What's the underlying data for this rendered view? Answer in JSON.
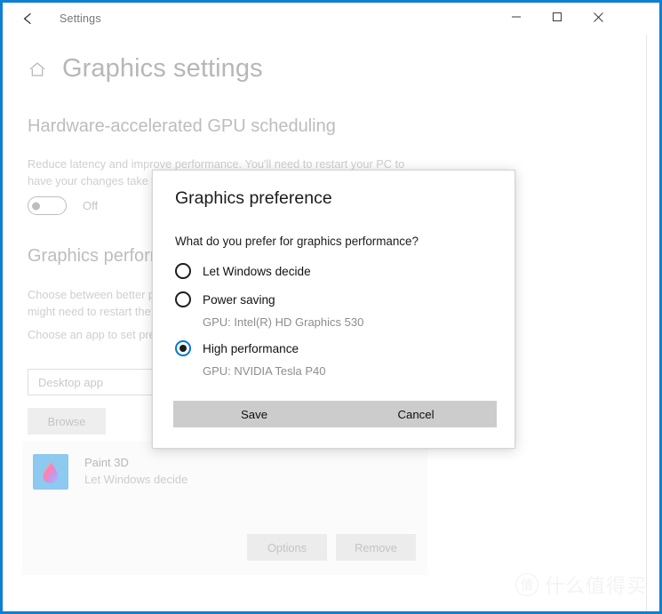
{
  "window": {
    "title": "Settings",
    "back_icon": "back-arrow-icon",
    "minimize_label": "─",
    "maximize_label": "□",
    "close_label": "✕",
    "border_color": "#0f7fd4"
  },
  "page": {
    "home_icon": "home-icon",
    "title": "Graphics settings"
  },
  "hardware_section": {
    "heading": "Hardware-accelerated GPU scheduling",
    "description": "Reduce latency and improve performance. You'll need to restart your PC to have your changes take effect.",
    "toggle_state": "Off"
  },
  "performance_section": {
    "heading": "Graphics performance preference",
    "description": "Choose between better performance or battery life when running an app. You might need to restart the app for your changes to take effect.",
    "choose_label": "Choose an app to set preference",
    "app_type_value": "Desktop app",
    "browse_label": "Browse"
  },
  "app_card": {
    "icon": "paint-3d-icon",
    "name": "Paint 3D",
    "preference": "Let Windows decide",
    "options_label": "Options",
    "remove_label": "Remove"
  },
  "dialog": {
    "title": "Graphics preference",
    "question": "What do you prefer for graphics performance?",
    "options": [
      {
        "label": "Let Windows decide",
        "selected": false,
        "gpu": ""
      },
      {
        "label": "Power saving",
        "selected": false,
        "gpu": "GPU: Intel(R) HD Graphics 530"
      },
      {
        "label": "High performance",
        "selected": true,
        "gpu": "GPU: NVIDIA Tesla P40"
      }
    ],
    "save_label": "Save",
    "cancel_label": "Cancel",
    "accent_color": "#0078d7"
  },
  "watermark": {
    "mark": "值",
    "text": "什么值得买"
  }
}
